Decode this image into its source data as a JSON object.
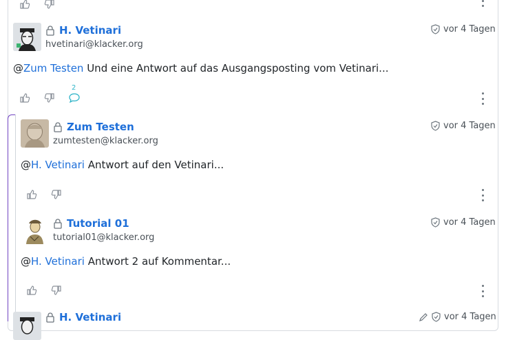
{
  "top_actions": {
    "upvote_label": "upvote",
    "downvote_label": "downvote"
  },
  "comments": [
    {
      "author": "H. Vetinari",
      "handle": "hvetinari@klacker.org",
      "time": "vor 4 Tagen",
      "mention": "@Zum Testen",
      "mention_at": "@",
      "mention_name": "Zum Testen",
      "text": " Und eine Antwort auf das Ausgangsposting vom Vetinari...",
      "reply_count": "2"
    },
    {
      "author": "Zum Testen",
      "handle": "zumtesten@klacker.org",
      "time": "vor 4 Tagen",
      "mention_at": "@",
      "mention_name": "H. Vetinari",
      "text": " Antwort auf den Vetinari..."
    },
    {
      "author": "Tutorial 01",
      "handle": "tutorial01@klacker.org",
      "time": "vor 4 Tagen",
      "mention_at": "@",
      "mention_name": "H. Vetinari",
      "text": " Antwort 2 auf Kommentar..."
    },
    {
      "author": "H. Vetinari",
      "time": "vor 4 Tagen"
    }
  ],
  "colors": {
    "accent": "#1e6fd9",
    "thread": "#6f42c1",
    "reply": "#2fb4c8"
  }
}
